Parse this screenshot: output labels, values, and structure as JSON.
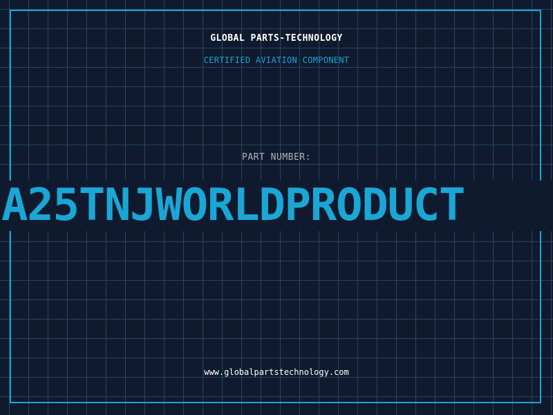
{
  "header": {
    "brand": "GLOBAL PARTS-TECHNOLOGY",
    "tagline": "CERTIFIED AVIATION COMPONENT"
  },
  "part": {
    "label": "PART NUMBER:",
    "number": "A25TNJWORLDPRODUCT"
  },
  "footer": {
    "url": "www.globalpartstechnology.com"
  },
  "colors": {
    "background": "#101a2e",
    "accent": "#1aa7d6",
    "grid": "#2c6e8c",
    "text": "#ffffff",
    "label": "#aab4c2"
  }
}
